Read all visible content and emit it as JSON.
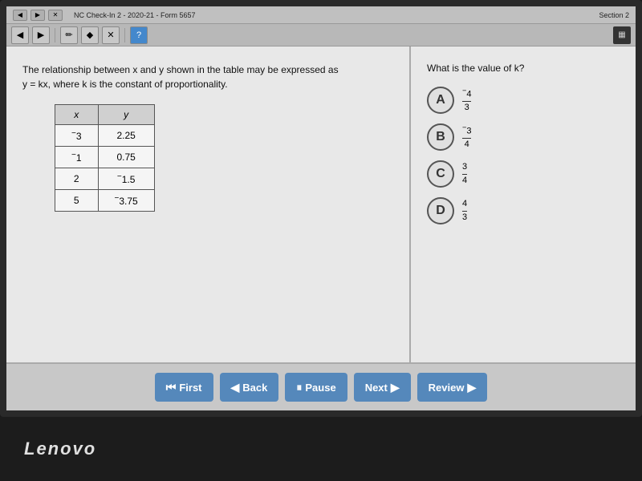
{
  "topbar": {
    "title": "NC Check-In 2 - 2020-21 - Form 5657",
    "section": "Section 2"
  },
  "question": {
    "left_text_line1": "The relationship between x and y shown in the table may be expressed as",
    "left_text_line2": "y = kx, where k is the constant of proportionality.",
    "table": {
      "headers": [
        "x",
        "y"
      ],
      "rows": [
        [
          "−3",
          "2.25"
        ],
        [
          "−1",
          "0.75"
        ],
        [
          "2",
          "−1.5"
        ],
        [
          "5",
          "−3.75"
        ]
      ]
    },
    "right_text": "What is the value of k?",
    "choices": [
      {
        "label": "A",
        "numerator": "−4",
        "denominator": "3"
      },
      {
        "label": "B",
        "numerator": "−3",
        "denominator": "4"
      },
      {
        "label": "C",
        "numerator": "3",
        "denominator": "4"
      },
      {
        "label": "D",
        "numerator": "4",
        "denominator": "3"
      }
    ]
  },
  "navigation": {
    "first_label": "First",
    "back_label": "Back",
    "pause_label": "Pause",
    "next_label": "Next",
    "review_label": "Review"
  },
  "branding": {
    "lenovo": "Lenovo"
  },
  "toolbar": {
    "back_arrow": "◀",
    "forward_arrow": "▶",
    "pencil": "✏",
    "marker": "✦",
    "x_mark": "✕",
    "help": "?"
  }
}
